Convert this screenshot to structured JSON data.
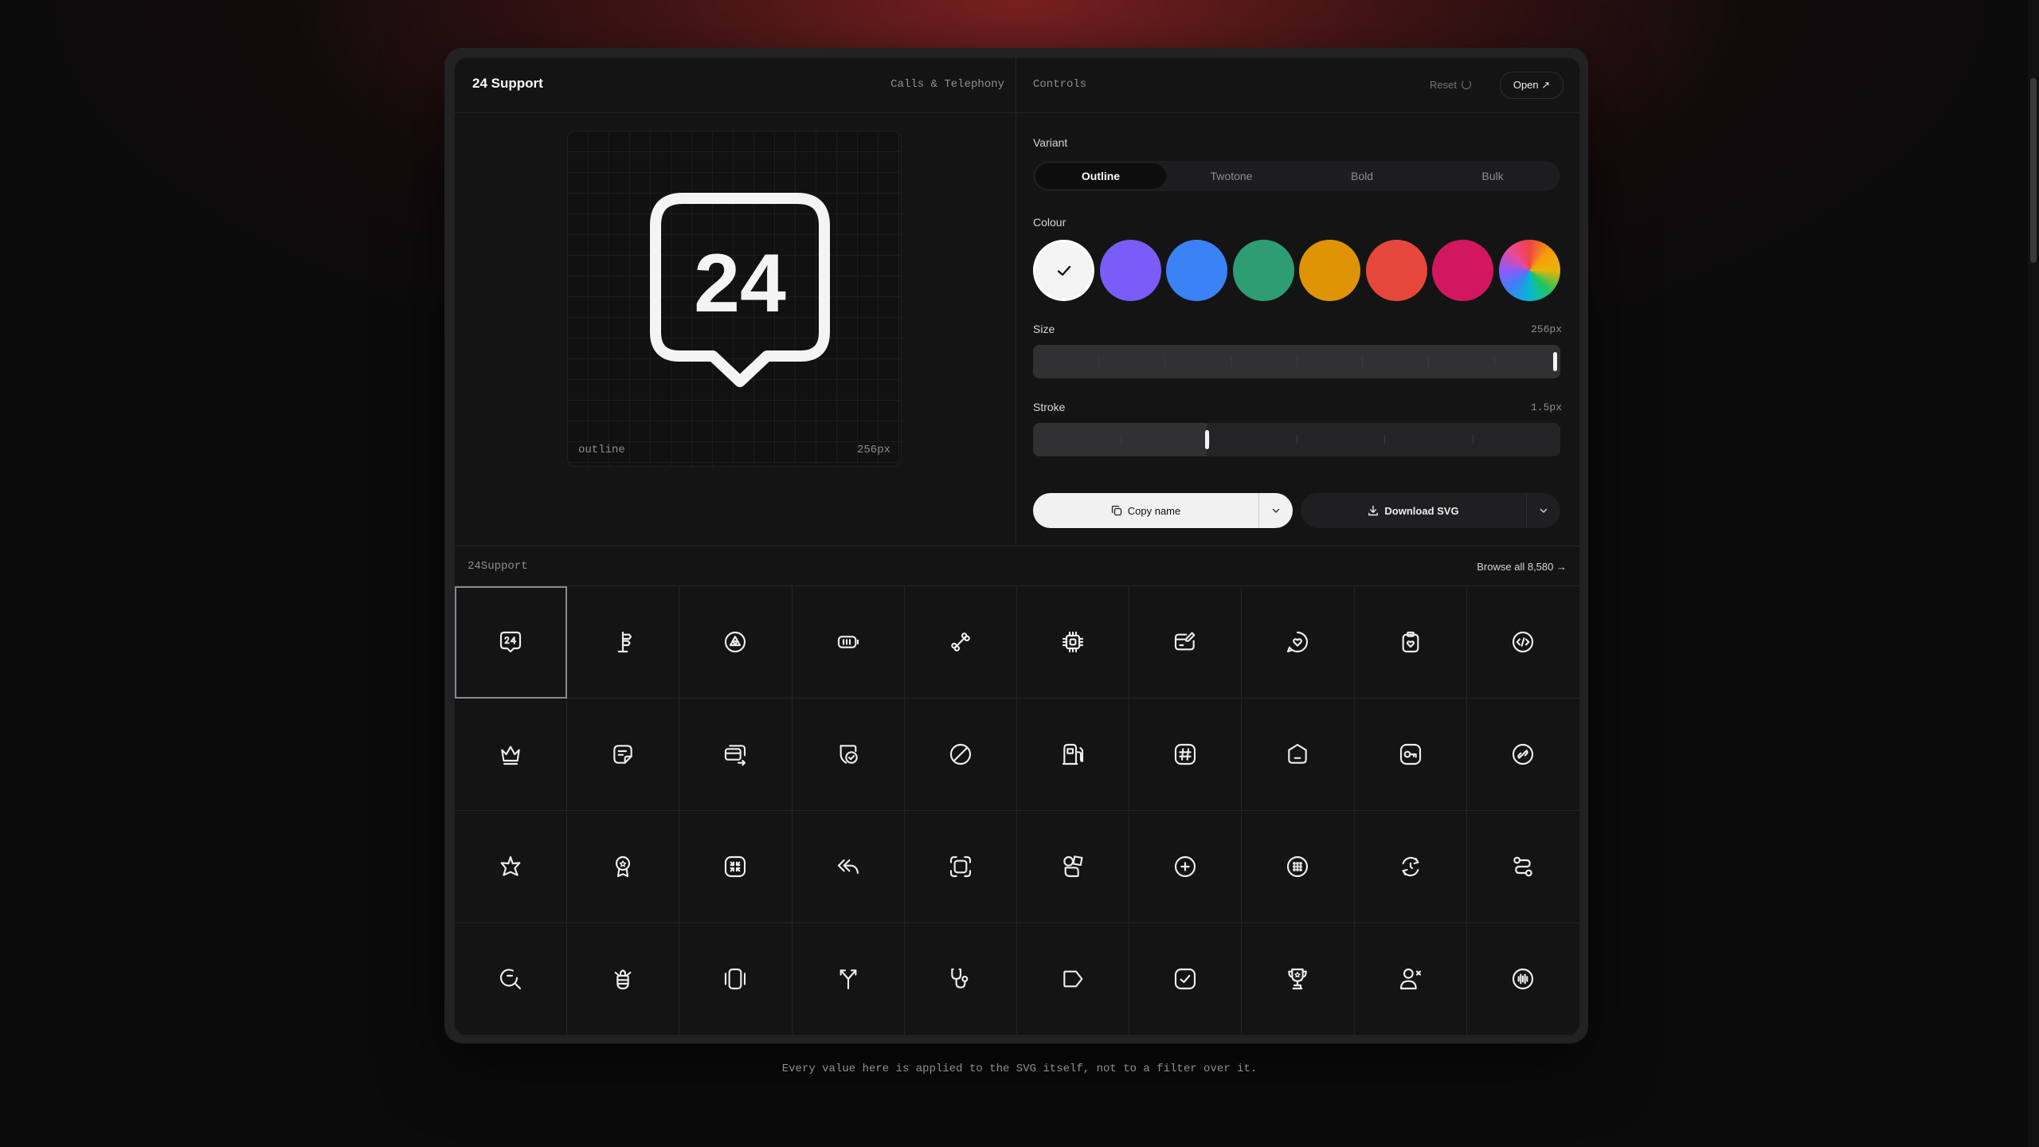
{
  "header": {
    "title": "24 Support",
    "category": "Calls & Telephony",
    "controls_label": "Controls",
    "reset_label": "Reset",
    "open_label": "Open ↗"
  },
  "preview": {
    "glyph": "24",
    "variant_caption": "outline",
    "size_caption": "256px"
  },
  "controls": {
    "variant_label": "Variant",
    "variants": [
      "Outline",
      "Twotone",
      "Bold",
      "Bulk"
    ],
    "selected_variant": "Outline",
    "colour_label": "Colour",
    "colours": [
      "#f4f4f4",
      "#7a5cf7",
      "#3b82f6",
      "#2e9e72",
      "#df9405",
      "#e5483b",
      "#d0175f",
      "rainbow"
    ],
    "selected_colour": "#f4f4f4",
    "size_label": "Size",
    "size_value": "256px",
    "size_fraction": 1.0,
    "stroke_label": "Stroke",
    "stroke_value": "1.5px",
    "stroke_fraction": 0.33,
    "copy_label": "Copy name",
    "download_label": "Download SVG"
  },
  "grid": {
    "section_name": "24Support",
    "browse_label": "Browse all 8,580 →",
    "icons": [
      "24-support-icon",
      "signpost-icon",
      "triangle-circle-icon",
      "battery-icon",
      "bone-icon",
      "cpu-chip-icon",
      "edit-card-icon",
      "chat-heart-icon",
      "clipboard-heart-icon",
      "code-circle-icon",
      "crown-icon",
      "note-icon",
      "cards-transfer-icon",
      "badge-check-icon",
      "forbidden-circle-icon",
      "fuel-station-icon",
      "hashtag-square-icon",
      "box-icon",
      "key-square-icon",
      "link-circle-icon",
      "star-icon",
      "medal-icon",
      "minimize-square-icon",
      "reply-all-icon",
      "frame-icon",
      "shapes-icon",
      "add-circle-icon",
      "dots-grid-circle-icon",
      "refresh-circle-icon",
      "route-icon",
      "search-refresh-icon",
      "bee-icon",
      "phone-vibrate-icon",
      "split-arrows-icon",
      "stethoscope-icon",
      "tag-icon",
      "checkbox-icon",
      "trophy-icon",
      "user-remove-icon",
      "soundwave-circle-icon"
    ]
  },
  "footer": {
    "note": "Every value here is applied to the SVG itself, not to a filter over it."
  }
}
